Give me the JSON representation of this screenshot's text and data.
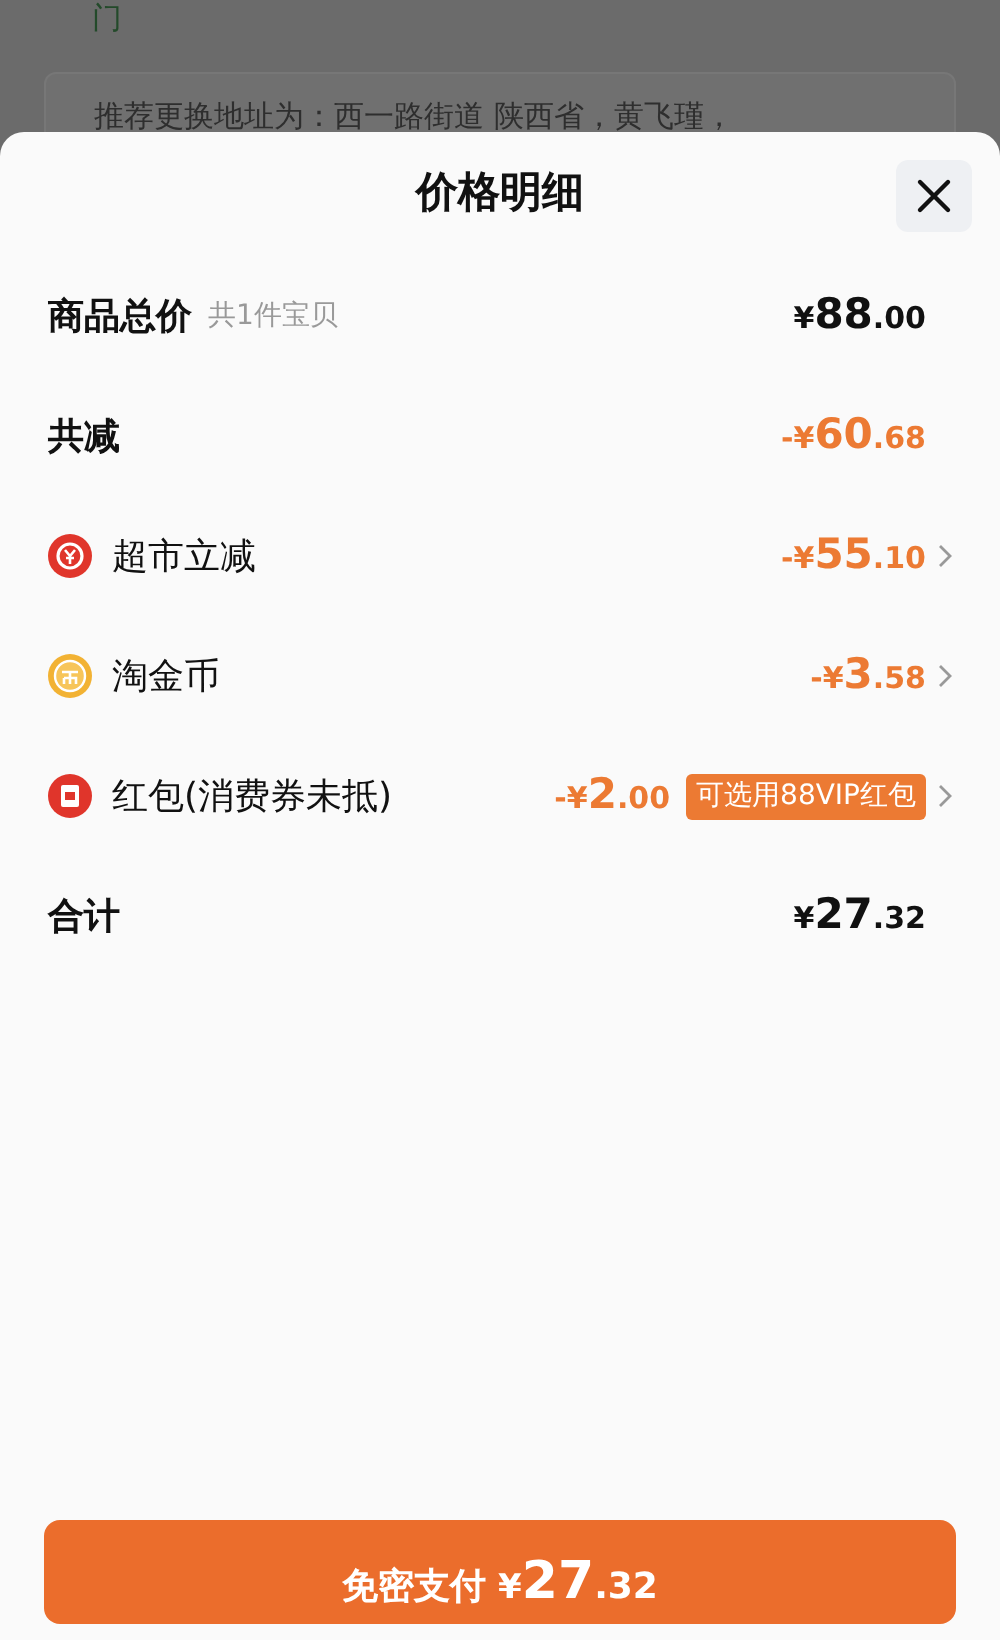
{
  "background": {
    "top_text": "门",
    "address_hint": "推荐更换地址为：西一路街道 陕西省，黄飞瑾，"
  },
  "sheet": {
    "title": "价格明细"
  },
  "rows": [
    {
      "kind": "total",
      "label": "商品总价",
      "note": "共1件宝贝",
      "price": {
        "prefix": "¥",
        "whole": "88",
        "fraction": ".00"
      }
    },
    {
      "kind": "reduction",
      "label": "共减",
      "price": {
        "prefix": "-¥",
        "whole": "60",
        "fraction": ".68"
      }
    },
    {
      "kind": "discount",
      "label": "超市立减",
      "price": {
        "prefix": "-¥",
        "whole": "55",
        "fraction": ".10"
      }
    },
    {
      "kind": "discount",
      "label": "淘金币",
      "price": {
        "prefix": "-¥",
        "whole": "3",
        "fraction": ".58"
      }
    },
    {
      "kind": "discount",
      "label": "红包(消费券未抵)",
      "price": {
        "prefix": "-¥",
        "whole": "2",
        "fraction": ".00"
      },
      "badge": "可选用88VIP红包"
    },
    {
      "kind": "total",
      "label": "合计",
      "price": {
        "prefix": "¥",
        "whole": "27",
        "fraction": ".32"
      }
    }
  ],
  "pay_button": {
    "label": "免密支付",
    "price": {
      "prefix": "¥",
      "whole": "27",
      "fraction": ".32"
    }
  }
}
